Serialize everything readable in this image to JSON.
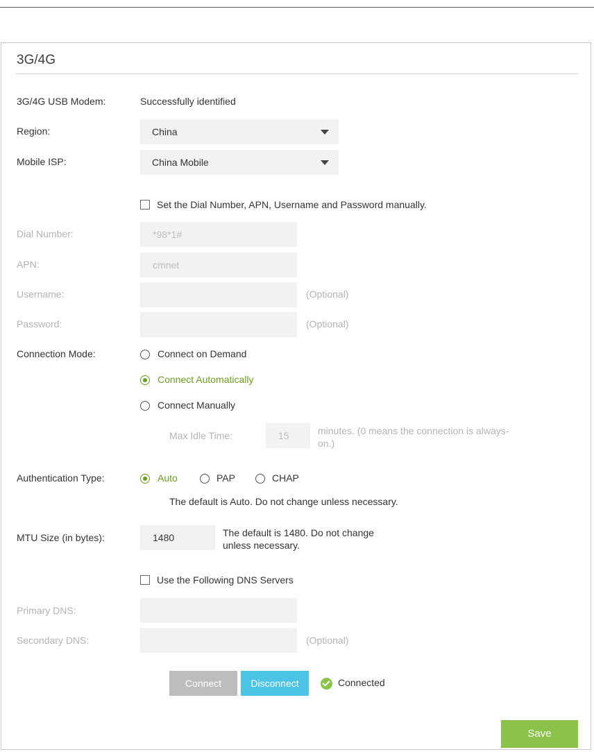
{
  "panel_title": "3G/4G",
  "usb_modem": {
    "label": "3G/4G USB Modem:",
    "status": "Successfully identified"
  },
  "region": {
    "label": "Region:",
    "value": "China"
  },
  "mobile_isp": {
    "label": "Mobile ISP:",
    "value": "China Mobile"
  },
  "manual_settings": {
    "label": "Set the Dial Number, APN, Username and Password manually.",
    "checked": false
  },
  "dial_number": {
    "label": "Dial Number:",
    "value": "*98*1#"
  },
  "apn": {
    "label": "APN:",
    "value": "cmnet"
  },
  "username": {
    "label": "Username:",
    "value": "",
    "hint": "(Optional)"
  },
  "password": {
    "label": "Password:",
    "value": "",
    "hint": "(Optional)"
  },
  "connection_mode": {
    "label": "Connection Mode:",
    "options": [
      "Connect on Demand",
      "Connect Automatically",
      "Connect Manually"
    ],
    "selected": "Connect Automatically",
    "max_idle_label": "Max Idle Time:",
    "max_idle_value": "15",
    "max_idle_note_1": "minutes. (0 means the connection is always-",
    "max_idle_note_2": "on.)"
  },
  "auth_type": {
    "label": "Authentication Type:",
    "options": [
      "Auto",
      "PAP",
      "CHAP"
    ],
    "selected": "Auto",
    "note": "The default is Auto. Do not change unless necessary."
  },
  "mtu": {
    "label": "MTU Size (in bytes):",
    "value": "1480",
    "note_1": "The default is 1480. Do not change",
    "note_2": "unless necessary."
  },
  "dns": {
    "label": "Use the Following DNS Servers",
    "checked": false
  },
  "primary_dns": {
    "label": "Primary DNS:",
    "value": ""
  },
  "secondary_dns": {
    "label": "Secondary DNS:",
    "value": "",
    "hint": "(Optional)"
  },
  "buttons": {
    "connect": "Connect",
    "disconnect": "Disconnect",
    "save": "Save"
  },
  "status": {
    "text": "Connected",
    "icon": "check-circle-icon"
  },
  "colors": {
    "accent_green": "#6a9e1f",
    "save_green": "#8bc34a",
    "disconnect_blue": "#4cc4e6",
    "connect_gray": "#bdbdbd"
  }
}
